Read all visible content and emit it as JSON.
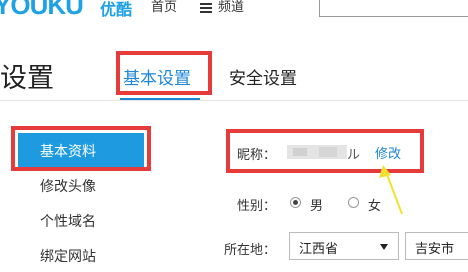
{
  "header": {
    "logo_text": "YOUKU",
    "logo_cn": "优酷",
    "nav_home": "首页",
    "nav_channels": "频道"
  },
  "page": {
    "title": "设置",
    "tabs": [
      {
        "label": "基本设置",
        "active": true
      },
      {
        "label": "安全设置",
        "active": false
      }
    ]
  },
  "sidebar": {
    "items": [
      {
        "label": "基本资料",
        "active": true
      },
      {
        "label": "修改头像",
        "active": false
      },
      {
        "label": "个性域名",
        "active": false
      },
      {
        "label": "绑定网站",
        "active": false
      }
    ]
  },
  "form": {
    "nickname_label": "昵称：",
    "nickname_visible_tail": "ル",
    "edit_link": "修改",
    "gender_label": "性别：",
    "gender_options": [
      {
        "label": "男",
        "checked": true
      },
      {
        "label": "女",
        "checked": false
      }
    ],
    "location_label": "所在地：",
    "province_value": "江西省",
    "city_value": "吉安市"
  },
  "colors": {
    "accent": "#1e87d6",
    "sidebar_active_bg": "#1e9be0",
    "annotation_red": "#e53b3b",
    "arrow_yellow": "#f2e230"
  }
}
